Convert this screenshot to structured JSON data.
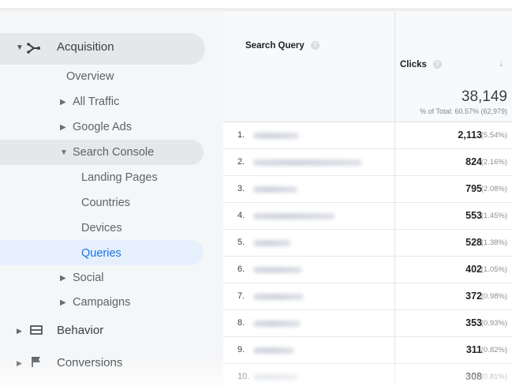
{
  "sidebar": {
    "acquisition": {
      "label": "Acquisition"
    },
    "items": [
      {
        "label": "Overview"
      },
      {
        "label": "All Traffic"
      },
      {
        "label": "Google Ads"
      },
      {
        "label": "Search Console"
      },
      {
        "label": "Landing Pages"
      },
      {
        "label": "Countries"
      },
      {
        "label": "Devices"
      },
      {
        "label": "Queries"
      },
      {
        "label": "Social"
      },
      {
        "label": "Campaigns"
      }
    ],
    "behavior": {
      "label": "Behavior"
    },
    "conversions": {
      "label": "Conversions"
    },
    "active_item": "Queries",
    "colors": {
      "active_text": "#1a73e8",
      "active_bg": "#e6f0fc",
      "selected_bg": "#e6e7e9"
    }
  },
  "table": {
    "columns": {
      "query": "Search Query",
      "clicks": "Clicks"
    },
    "total": {
      "value": "38,149",
      "percent": "% of Total: 60.57% (62,979)"
    },
    "rows": [
      {
        "rank": "1.",
        "clicks": "2,113",
        "pct": "(5.54%)"
      },
      {
        "rank": "2.",
        "clicks": "824",
        "pct": "(2.16%)"
      },
      {
        "rank": "3.",
        "clicks": "795",
        "pct": "(2.08%)"
      },
      {
        "rank": "4.",
        "clicks": "553",
        "pct": "(1.45%)"
      },
      {
        "rank": "5.",
        "clicks": "528",
        "pct": "(1.38%)"
      },
      {
        "rank": "6.",
        "clicks": "402",
        "pct": "(1.05%)"
      },
      {
        "rank": "7.",
        "clicks": "372",
        "pct": "(0.98%)"
      },
      {
        "rank": "8.",
        "clicks": "353",
        "pct": "(0.93%)"
      },
      {
        "rank": "9.",
        "clicks": "311",
        "pct": "(0.82%)"
      },
      {
        "rank": "10.",
        "clicks": "308",
        "pct": "(0.81%)"
      }
    ]
  }
}
